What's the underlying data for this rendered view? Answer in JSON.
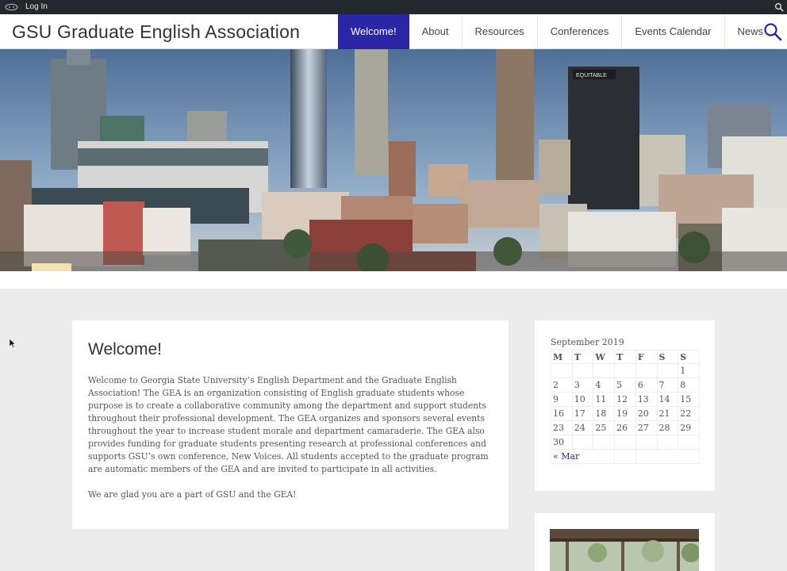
{
  "admin_bar": {
    "login_label": "Log In",
    "icons": [
      "wordpress-logo-icon",
      "search-icon"
    ]
  },
  "header": {
    "site_title": "GSU Graduate English Association",
    "nav": [
      {
        "label": "Welcome!",
        "active": true
      },
      {
        "label": "About",
        "active": false
      },
      {
        "label": "Resources",
        "active": false
      },
      {
        "label": "Conferences",
        "active": false
      },
      {
        "label": "Events Calendar",
        "active": false
      },
      {
        "label": "News",
        "active": false
      }
    ],
    "search_icon": "search-icon"
  },
  "hero": {
    "billboard_text": "EQUITABLE"
  },
  "main": {
    "title": "Welcome!",
    "paragraphs": [
      "Welcome to Georgia State University’s English Department and the Graduate English Association! The GEA is an organization consisting of English graduate students whose purpose is to create a collaborative community among the department and support students throughout their professional development. The GEA organizes and sponsors several events throughout the year to increase student morale and department camaraderie. The GEA also provides funding for graduate students presenting research at professional conferences and supports GSU’s own conference, New Voices. All students accepted to the graduate program are automatic members of the GEA and are invited to participate in all activities.",
      "We are glad you are a part of GSU and the GEA!"
    ]
  },
  "sidebar": {
    "calendar": {
      "caption": "September 2019",
      "weekdays": [
        "M",
        "T",
        "W",
        "T",
        "F",
        "S",
        "S"
      ],
      "weeks": [
        [
          "",
          "",
          "",
          "",
          "",
          "",
          "1"
        ],
        [
          "2",
          "3",
          "4",
          "5",
          "6",
          "7",
          "8"
        ],
        [
          "9",
          "10",
          "11",
          "12",
          "13",
          "14",
          "15"
        ],
        [
          "16",
          "17",
          "18",
          "19",
          "20",
          "21",
          "22"
        ],
        [
          "23",
          "24",
          "25",
          "26",
          "27",
          "28",
          "29"
        ],
        [
          "30",
          "",
          "",
          "",
          "",
          "",
          ""
        ]
      ],
      "prev_label": "« Mar"
    }
  },
  "colors": {
    "accent": "#2a26a6",
    "admin_bar": "#23282d",
    "page_background": "#ececec"
  }
}
